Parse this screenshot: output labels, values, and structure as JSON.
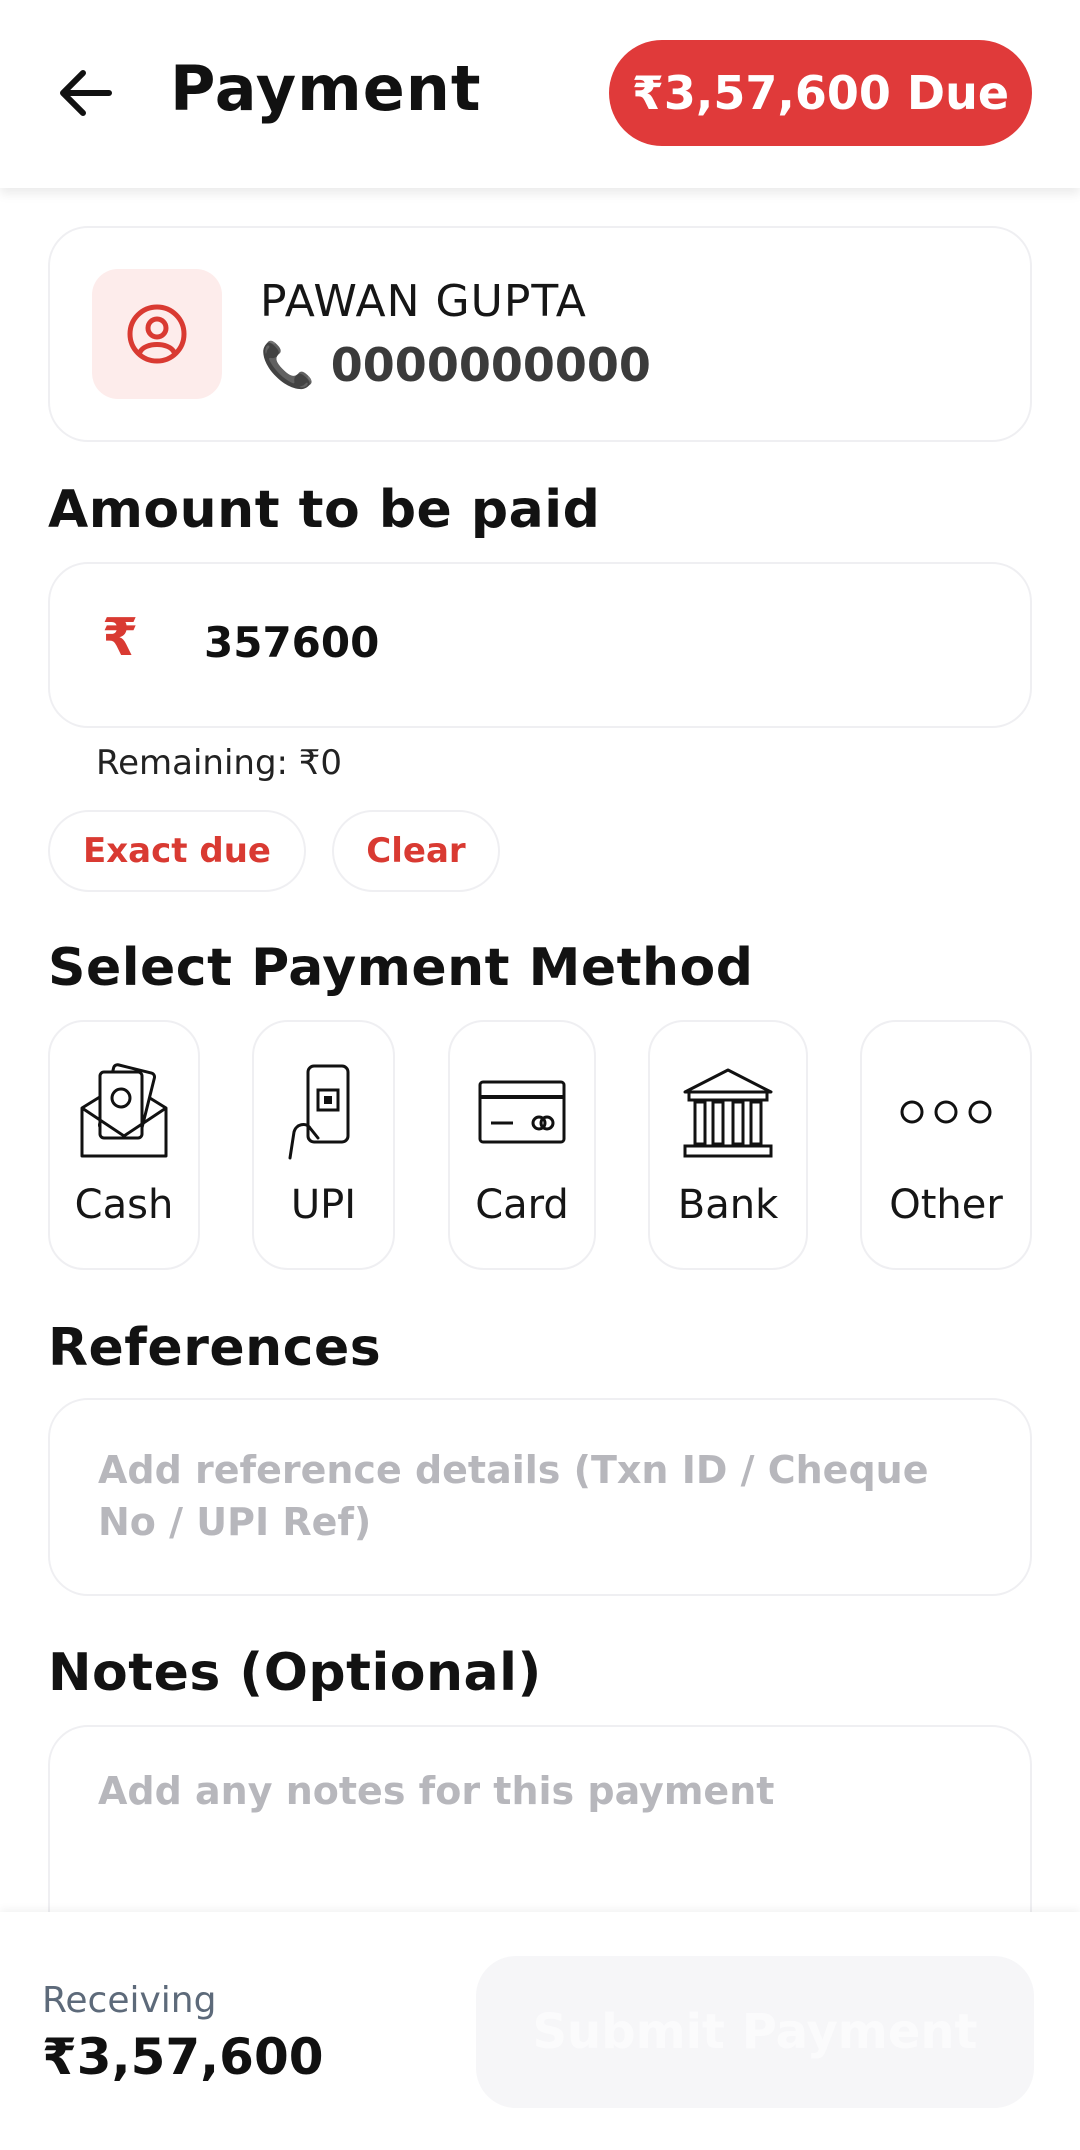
{
  "header": {
    "title": "Payment",
    "due_badge": "₹3,57,600 Due",
    "back_icon": "arrow-left-icon"
  },
  "customer": {
    "name": "PAWAN GUPTA",
    "phone": "0000000000",
    "avatar_icon": "user-circle-icon",
    "phone_icon": "phone-icon"
  },
  "amount": {
    "section_title": "Amount to be paid",
    "currency_symbol": "₹",
    "value": "357600",
    "remaining": "Remaining: ₹0",
    "chips": [
      "Exact due",
      "Clear"
    ]
  },
  "payment_methods": {
    "section_title": "Select Payment Method",
    "items": [
      {
        "label": "Cash",
        "icon": "cash-envelope-icon"
      },
      {
        "label": "UPI",
        "icon": "phone-qr-icon"
      },
      {
        "label": "Card",
        "icon": "credit-card-icon"
      },
      {
        "label": "Bank",
        "icon": "bank-building-icon"
      },
      {
        "label": "Other",
        "icon": "more-dots-icon"
      }
    ]
  },
  "references": {
    "section_title": "References",
    "placeholder": "Add reference details (Txn ID / Cheque No / UPI Ref)"
  },
  "notes": {
    "section_title": "Notes (Optional)",
    "placeholder": "Add any notes for this payment"
  },
  "footer": {
    "receiving_label": "Receiving",
    "receiving_amount": "₹3,57,600",
    "submit_label": "Submit Payment"
  },
  "colors": {
    "accent": "#e03a3a",
    "accent_text": "#d93a32",
    "border": "#efeff2",
    "placeholder": "#b7b7bc"
  }
}
